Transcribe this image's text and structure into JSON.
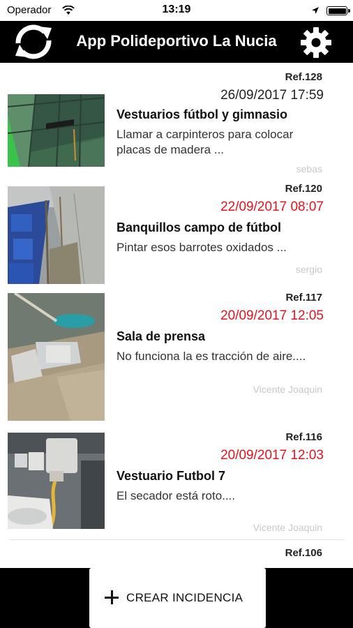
{
  "status_bar": {
    "carrier": "Operador",
    "time": "13:19"
  },
  "header": {
    "title": "App Polideportivo La Nucia",
    "refresh_icon": "refresh-icon",
    "settings_icon": "gear-icon"
  },
  "incidents": [
    {
      "ref": "Ref.128",
      "date": "26/09/2017 17:59",
      "date_color": "#222222",
      "title": "Vestuarios fútbol y gimnasio",
      "description": "Llamar a carpinteros para colocar placas de madera ...",
      "author": "sebas",
      "thumbnail": "wall-with-gap-photo"
    },
    {
      "ref": "Ref.120",
      "date": "22/09/2017 08:07",
      "date_color": "#e8121a",
      "title": "Banquillos campo de fútbol",
      "description": "Pintar esos barrotes oxidados ...",
      "author": "sergio",
      "thumbnail": "bench-seats-photo"
    },
    {
      "ref": "Ref.117",
      "date": "20/09/2017 12:05",
      "date_color": "#e8121a",
      "title": "Sala de prensa",
      "description": "No funciona la es tracción de aire....",
      "author": "Vicente Joaquin",
      "thumbnail": "ceiling-extractor-photo"
    },
    {
      "ref": "Ref.116",
      "date": "20/09/2017 12:03",
      "date_color": "#e8121a",
      "title": "Vestuario Futbol 7",
      "description": "El secador está roto....",
      "author": "Vicente Joaquin",
      "thumbnail": "hand-dryer-photo"
    },
    {
      "ref": "Ref.106",
      "date": "",
      "date_color": "#e8121a",
      "title": "",
      "description": "",
      "author": "",
      "thumbnail": ""
    }
  ],
  "footer": {
    "create_label": "CREAR INCIDENCIA",
    "plus_icon": "plus-icon"
  }
}
